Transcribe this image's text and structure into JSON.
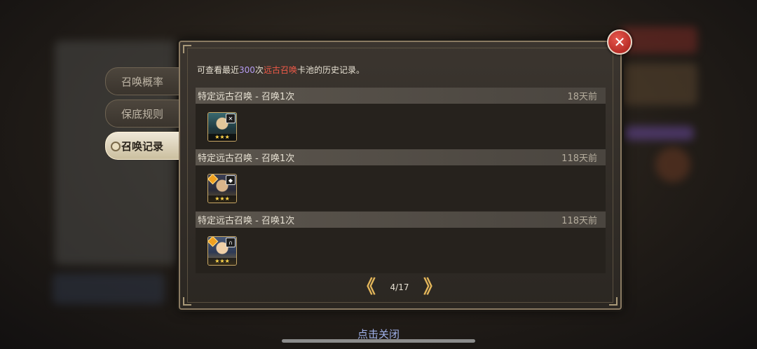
{
  "tabs": [
    {
      "label": "召唤概率",
      "active": false
    },
    {
      "label": "保底规则",
      "active": false
    },
    {
      "label": "召唤记录",
      "active": true
    }
  ],
  "info": {
    "prefix": "可查看最近",
    "count": "300",
    "count_unit": "次",
    "pool": "远古召唤",
    "suffix": "卡池的历史记录。"
  },
  "records": [
    {
      "title": "特定远古召唤 - 召唤1次",
      "time": "18天前",
      "hero_icon": "hero-portrait-icon",
      "type_icon": "sword-crossed-icon",
      "stars": "★★★"
    },
    {
      "title": "特定远古召唤 - 召唤1次",
      "time": "118天前",
      "hero_icon": "hero-portrait-icon",
      "type_icon": "shield-icon",
      "stars": "★★★"
    },
    {
      "title": "特定远古召唤 - 召唤1次",
      "time": "118天前",
      "hero_icon": "hero-portrait-icon",
      "type_icon": "bow-icon",
      "stars": "★★★"
    }
  ],
  "pager": {
    "prev": "《",
    "page": "4/17",
    "next": "》"
  },
  "footer": {
    "tap_close": "点击关闭"
  },
  "close": {
    "glyph": "✕"
  },
  "colors": {
    "count_highlight": "#b69cf2",
    "pool_highlight": "#f05a48",
    "close_button": "#d0322a",
    "active_tab": "#e6dcc4"
  }
}
